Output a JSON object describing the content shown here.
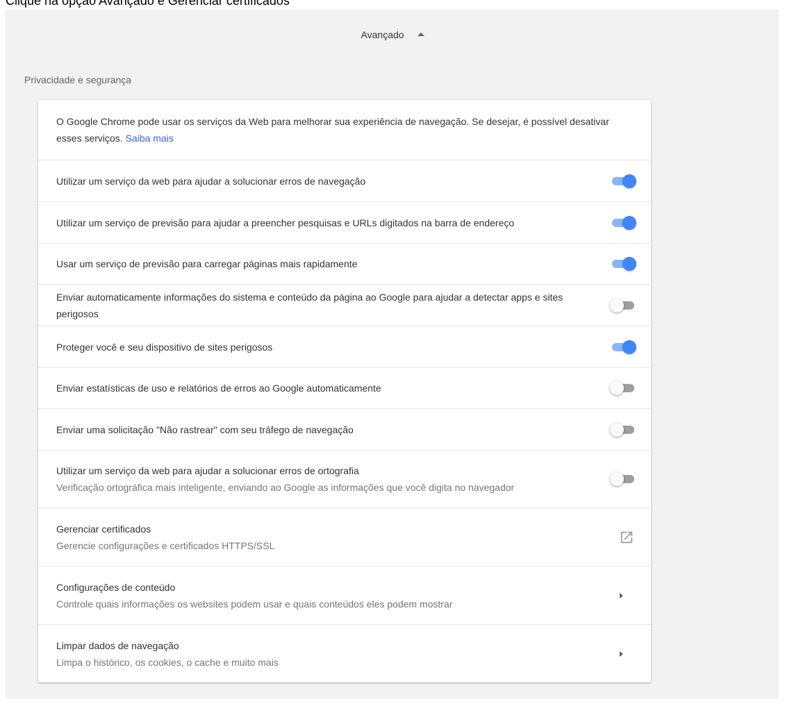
{
  "instruction": "Clique na opção Avançado e Gerenciar certificados",
  "advanced": {
    "label": "Avançado"
  },
  "section": {
    "title": "Privacidade e segurança"
  },
  "intro": {
    "text": "O Google Chrome pode usar os serviços da Web para melhorar sua experiência de navegação. Se desejar, é possível desativar esses serviços.",
    "link": "Saiba mais"
  },
  "settings": [
    {
      "label": "Utilizar um serviço da web para ajudar a solucionar erros de navegação",
      "enabled": true
    },
    {
      "label": "Utilizar um serviço de previsão para ajudar a preencher pesquisas e URLs digitados na barra de endereço",
      "enabled": true
    },
    {
      "label": "Usar um serviço de previsão para carregar páginas mais rapidamente",
      "enabled": true
    },
    {
      "label": "Enviar automaticamente informações do sistema e conteúdo da página ao Google para ajudar a detectar apps e sites perigosos",
      "enabled": false
    },
    {
      "label": "Proteger você e seu dispositivo de sites perigosos",
      "enabled": true
    },
    {
      "label": "Enviar estatísticas de uso e relatórios de erros ao Google automaticamente",
      "enabled": false
    },
    {
      "label": "Enviar uma solicitação \"Não rastrear\" com seu tráfego de navegação",
      "enabled": false
    },
    {
      "label": "Utilizar um serviço da web para ajudar a solucionar erros de ortografia",
      "sublabel": "Verificação ortográfica mais inteligente, enviando ao Google as informações que você digita no navegador",
      "enabled": false
    }
  ],
  "links": [
    {
      "label": "Gerenciar certificados",
      "sublabel": "Gerencie configurações e certificados HTTPS/SSL",
      "icon": "open-in-new-icon"
    },
    {
      "label": "Configurações de conteúdo",
      "sublabel": "Controle quais informações os websites podem usar e quais conteúdos eles podem mostrar",
      "icon": "chevron-right-icon"
    },
    {
      "label": "Limpar dados de navegação",
      "sublabel": "Limpa o histórico, os cookies, o cache e muito mais",
      "icon": "chevron-right-icon"
    }
  ],
  "colors": {
    "accent": "#4285f4",
    "link": "#3367d6",
    "background": "#f2f2f2"
  }
}
